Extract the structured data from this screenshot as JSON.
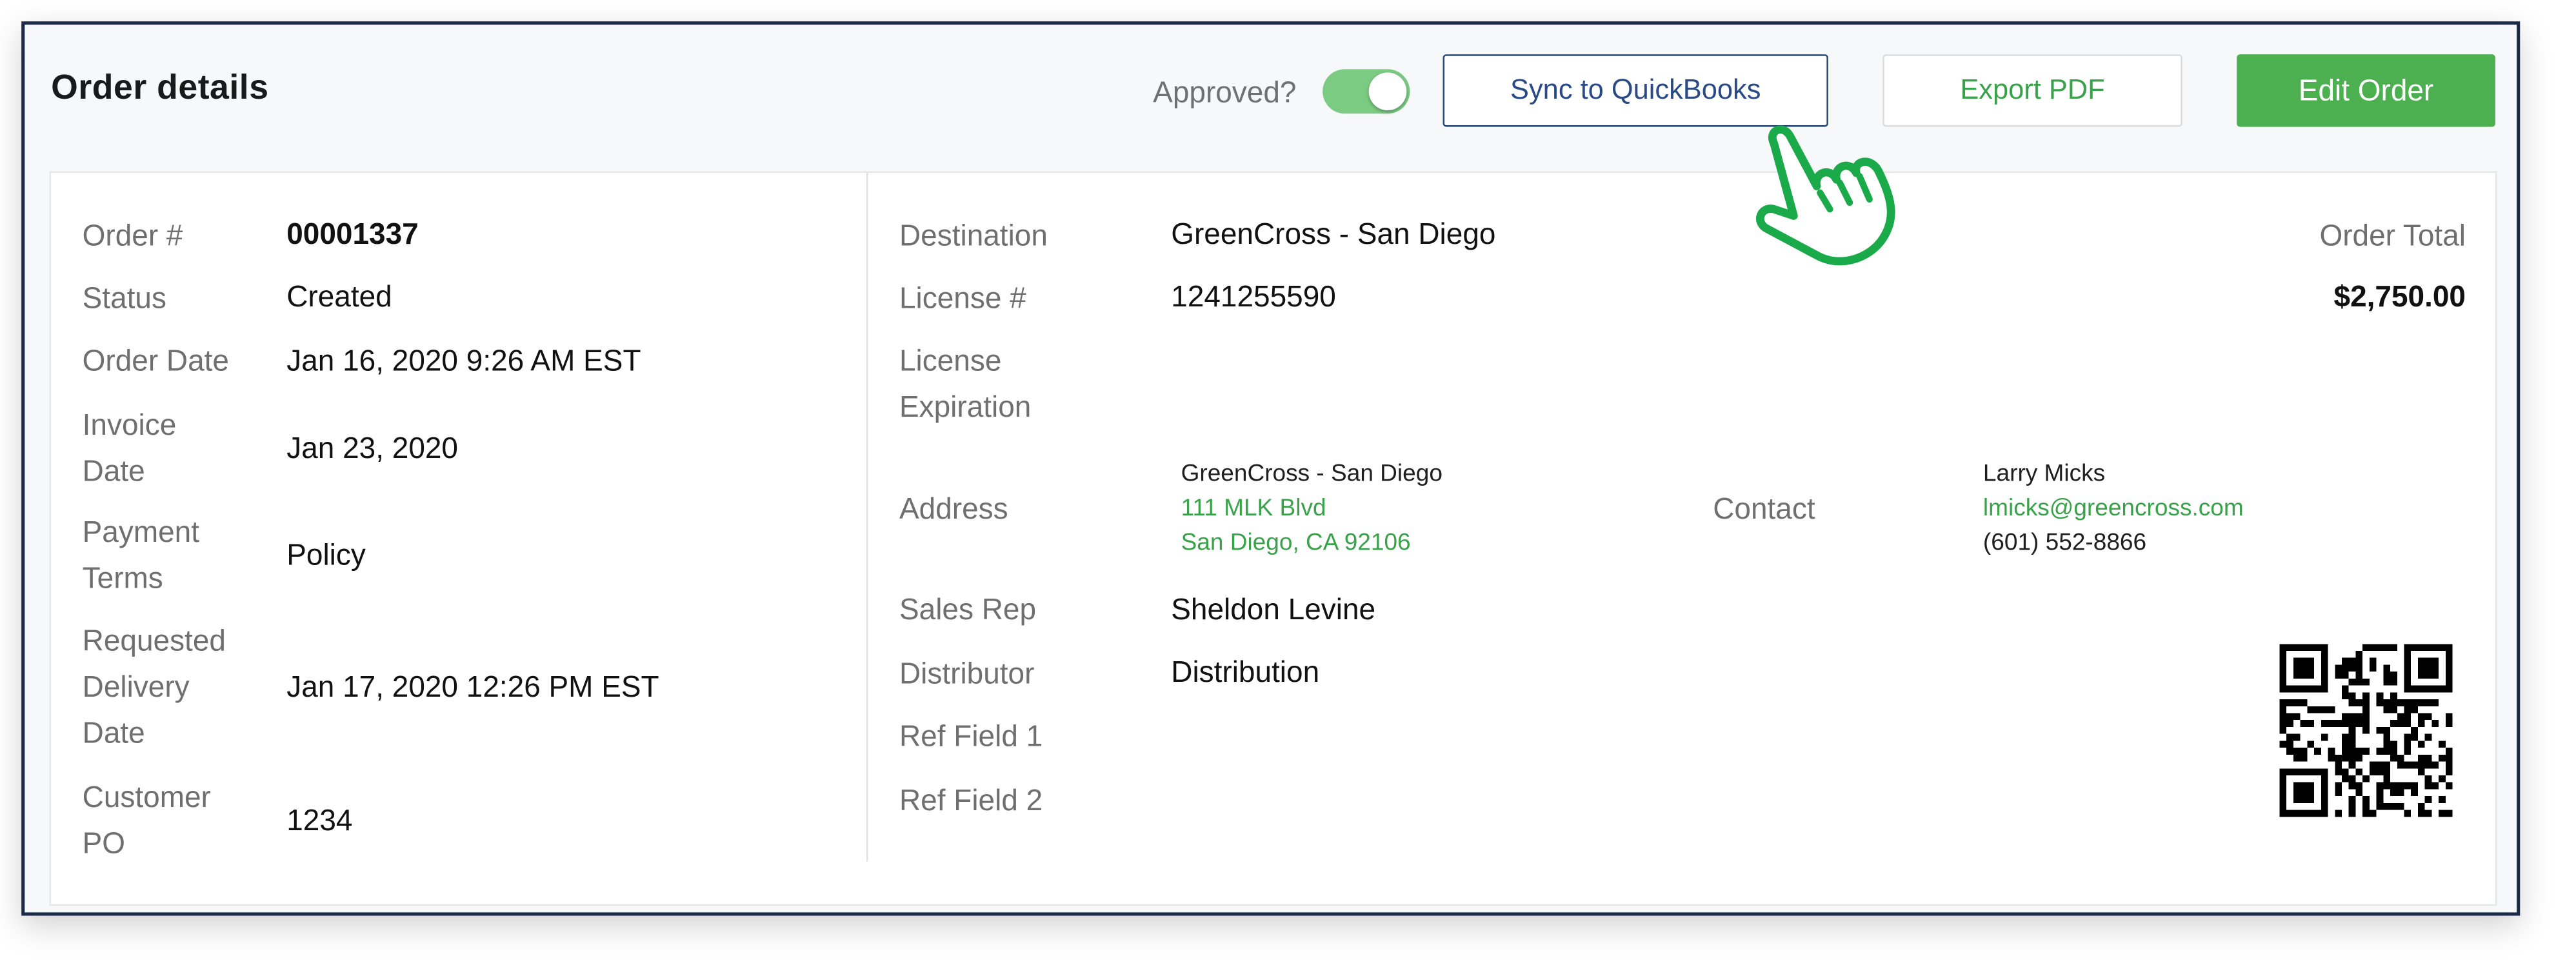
{
  "header": {
    "title": "Order details",
    "approved_label": "Approved?",
    "approved": true,
    "sync_label": "Sync to QuickBooks",
    "export_label": "Export PDF",
    "edit_label": "Edit Order"
  },
  "left": {
    "order_no_label": "Order #",
    "order_no": "00001337",
    "status_label": "Status",
    "status": "Created",
    "order_date_label": "Order Date",
    "order_date": "Jan 16, 2020 9:26 AM EST",
    "invoice_label_1": "Invoice",
    "invoice_label_2": "Date",
    "invoice_date": "Jan 23, 2020",
    "payment_label_1": "Payment",
    "payment_label_2": "Terms",
    "payment_terms": "Policy",
    "req_label_1": "Requested",
    "req_label_2": "Delivery",
    "req_label_3": "Date",
    "req_date": "Jan 17, 2020 12:26 PM EST",
    "po_label_1": "Customer",
    "po_label_2": "PO",
    "customer_po": "1234"
  },
  "right": {
    "destination_label": "Destination",
    "destination": "GreenCross - San Diego",
    "license_label": "License #",
    "license": "1241255590",
    "license_exp_label_1": "License",
    "license_exp_label_2": "Expiration",
    "address_label": "Address",
    "address_name": "GreenCross - San Diego",
    "address_line1": "111 MLK Blvd",
    "address_line2": "San Diego, CA 92106",
    "contact_label": "Contact",
    "contact_name": "Larry Micks",
    "contact_email": "lmicks@greencross.com",
    "contact_phone": "(601) 552-8866",
    "sales_rep_label": "Sales Rep",
    "sales_rep": "Sheldon Levine",
    "distributor_label": "Distributor",
    "distributor": "Distribution",
    "ref1_label": "Ref Field 1",
    "ref2_label": "Ref Field 2",
    "total_label": "Order Total",
    "total": "$2,750.00"
  },
  "icons": {
    "pointer": "hand-pointer-icon",
    "qr": "qr-code-icon"
  },
  "colors": {
    "accent_green": "#4caf50",
    "link_green": "#3aa24a",
    "sync_blue": "#2a4a86",
    "toggle_on": "#7ccb83",
    "hand_outline": "#1aaa4a"
  }
}
